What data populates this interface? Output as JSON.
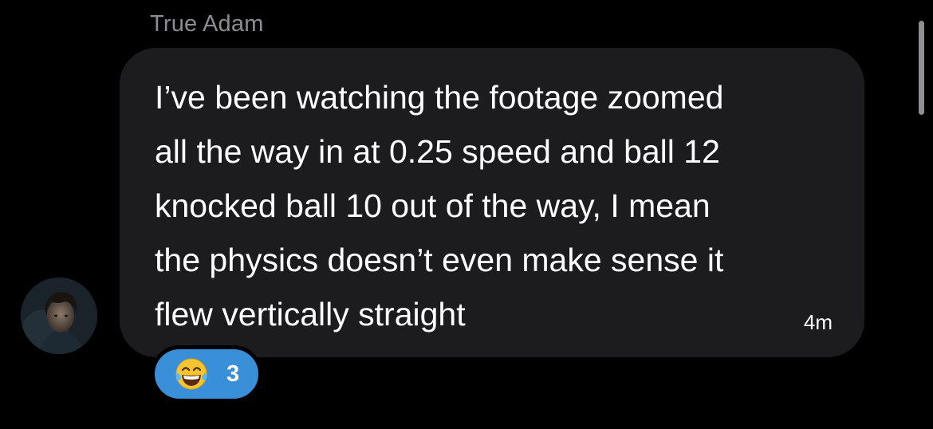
{
  "message": {
    "sender": "True Adam",
    "text": "I’ve been watching the footage zoomed\nall the way in at 0.25 speed and ball 12\nknocked ball 10 out of the way, I mean\nthe physics doesn’t even make sense it\nflew vertically straight",
    "timestamp": "4m",
    "avatar_icon": "user-avatar"
  },
  "reaction": {
    "emoji_icon": "tears-of-joy-emoji-icon",
    "count": "3"
  },
  "colors": {
    "background": "#000000",
    "bubble": "#1c1c1e",
    "sender_name": "#8a8d91",
    "reaction_pill": "#3a8fd9",
    "scrollbar": "#8e8e93"
  }
}
